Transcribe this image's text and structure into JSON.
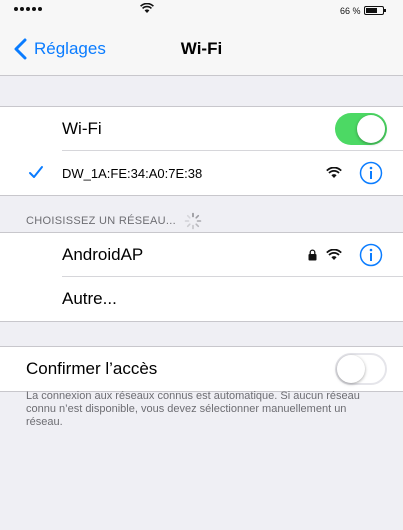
{
  "status_bar": {
    "battery_text": "66 %",
    "battery_level": 0.66
  },
  "nav": {
    "back_label": "Réglages",
    "title": "Wi-Fi"
  },
  "wifi_toggle": {
    "label": "Wi-Fi",
    "on": true
  },
  "connected_network": {
    "name": "DW_1A:FE:34:A0:7E:38"
  },
  "networks_section": {
    "header": "CHOISISSEZ UN RÉSEAU..."
  },
  "networks": [
    {
      "name": "AndroidAP",
      "locked": true
    },
    {
      "name": "Autre..."
    }
  ],
  "ask_to_join": {
    "label": "Confirmer l’accès",
    "on": false,
    "description": "La connexion aux réseaux connus est automatique. Si aucun réseau connu n’est disponible, vous devez sélectionner manuellement un réseau."
  },
  "colors": {
    "accent": "#0a7cff",
    "switch_on": "#4cd964",
    "background": "#efeff4"
  }
}
